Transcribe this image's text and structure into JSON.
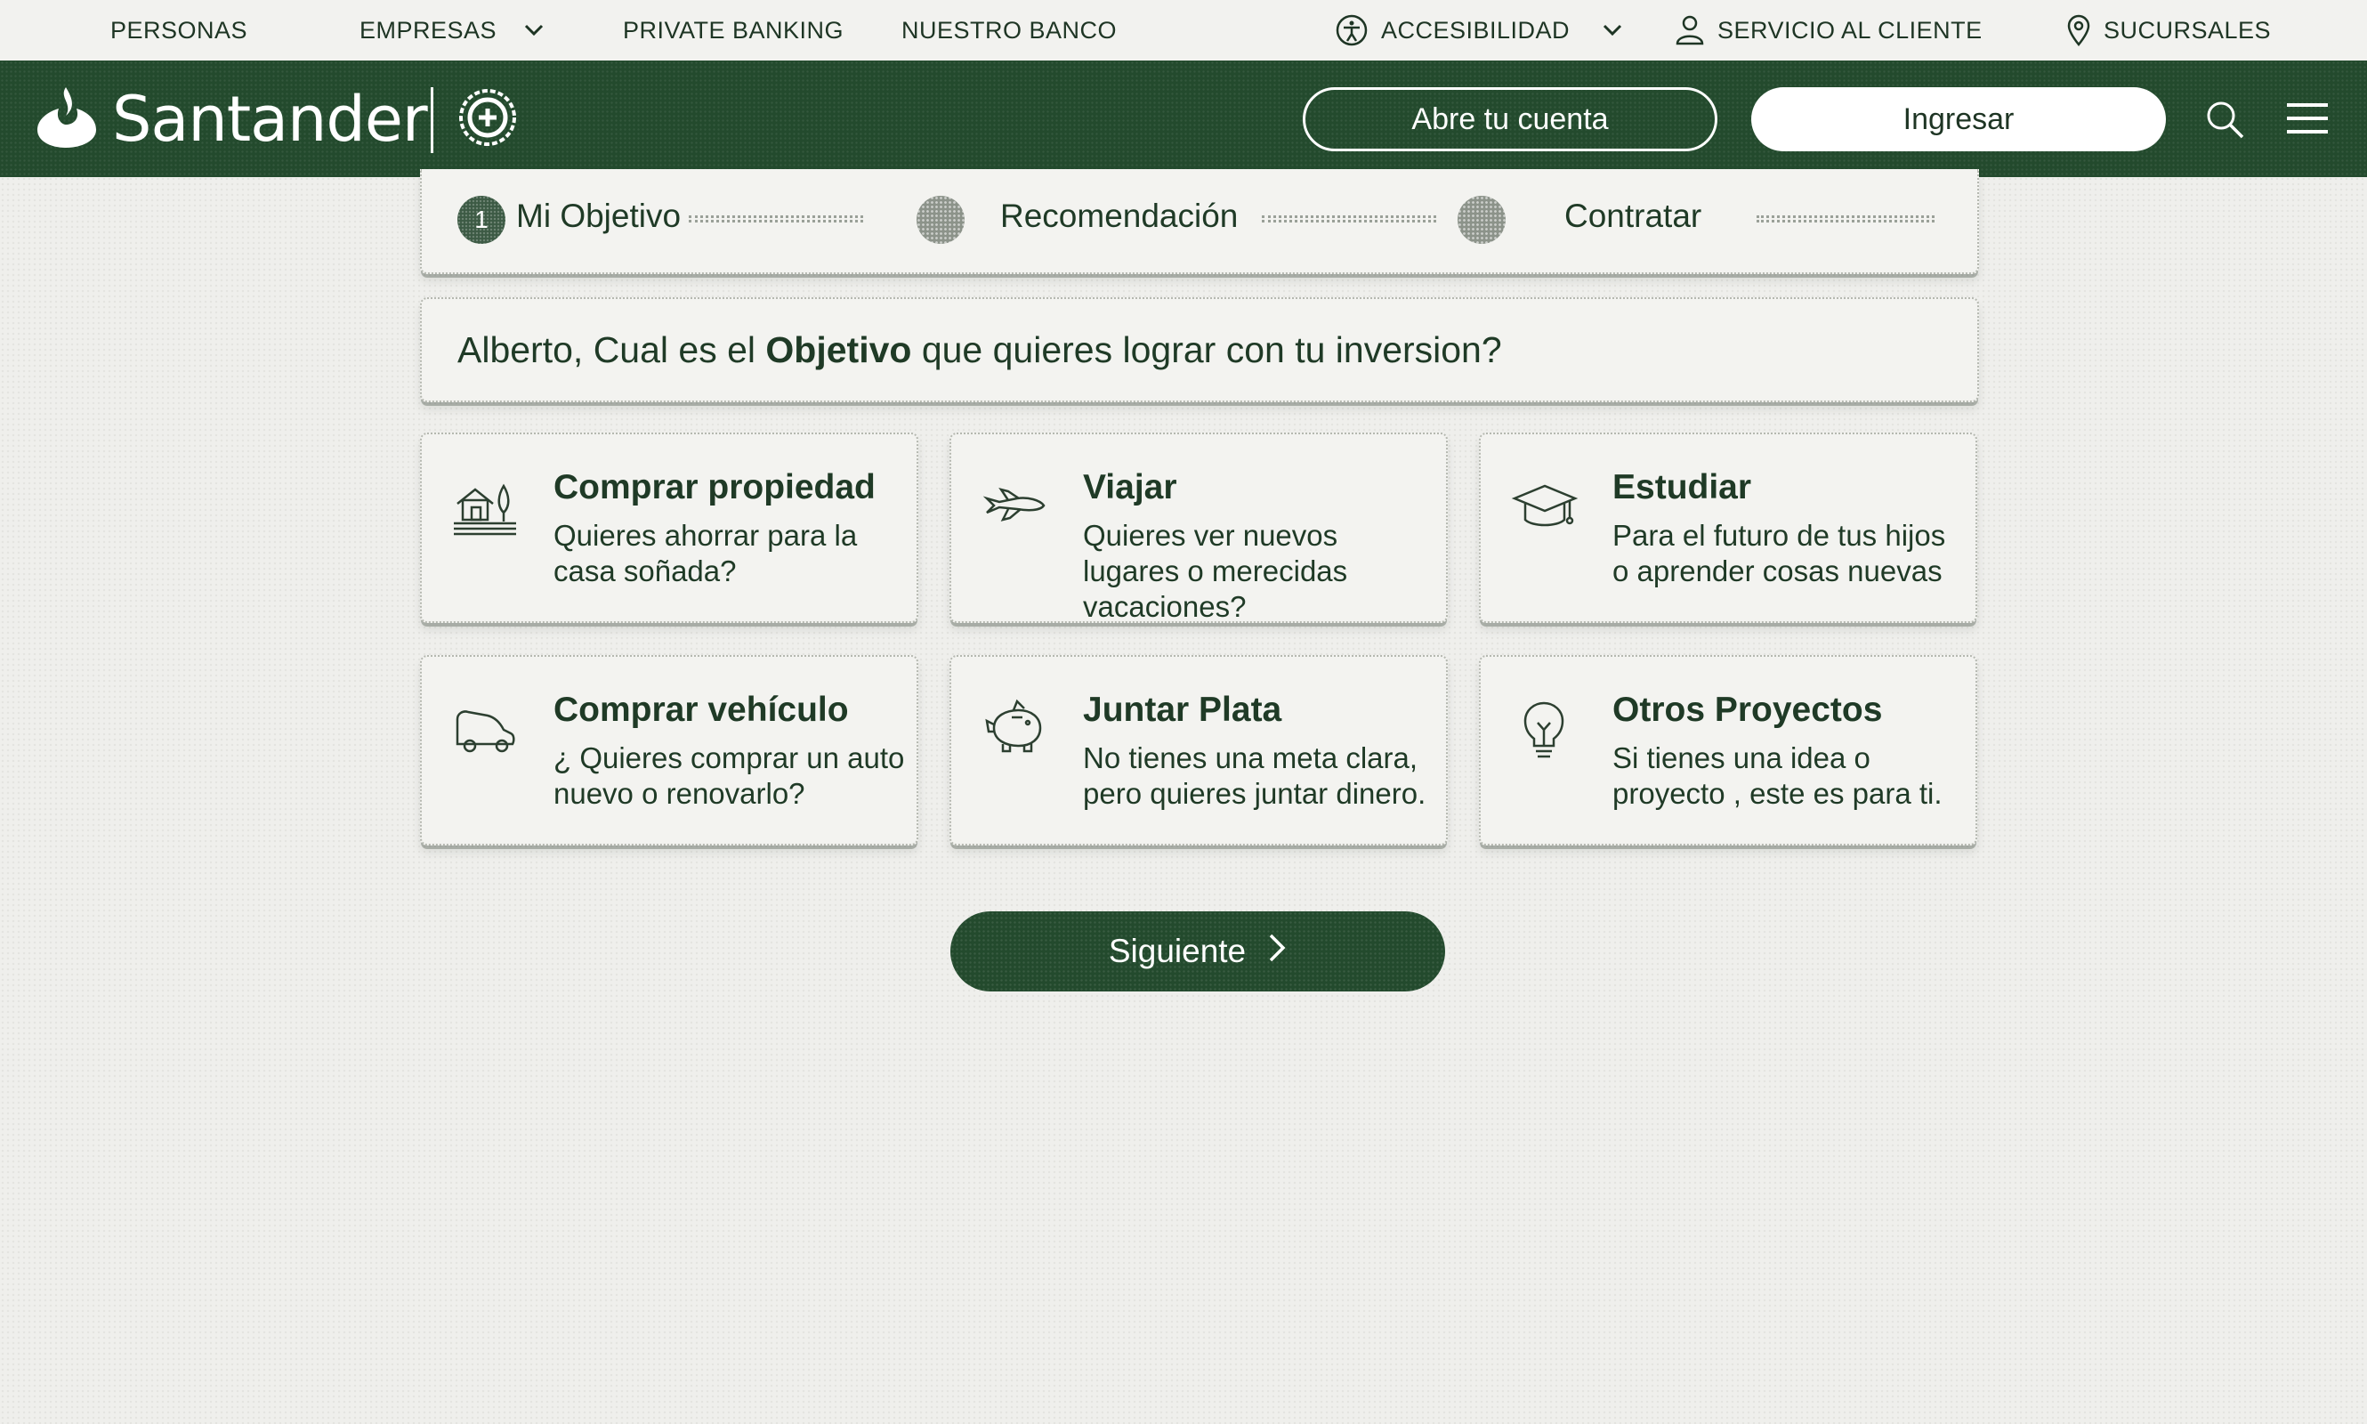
{
  "topnav": {
    "personas": "PERSONAS",
    "empresas": "EMPRESAS",
    "private_banking": "PRIVATE BANKING",
    "nuestro_banco": "NUESTRO BANCO",
    "accesibilidad": "ACCESIBILIDAD",
    "servicio_cliente": "SERVICIO AL CLIENTE",
    "sucursales": "SUCURSALES"
  },
  "header": {
    "brand": "Santander",
    "open_account": "Abre tu cuenta",
    "login": "Ingresar"
  },
  "stepper": {
    "steps": [
      {
        "number": "1",
        "label": "Mi Objetivo",
        "active": true
      },
      {
        "number": "",
        "label": "Recomendación",
        "active": false
      },
      {
        "number": "",
        "label": "Contratar",
        "active": false
      }
    ]
  },
  "question": {
    "prefix": "Alberto, Cual es el ",
    "emphasis": "Objetivo",
    "suffix": " que quieres lograr con tu inversion?"
  },
  "options": [
    {
      "icon": "house-icon",
      "title": "Comprar propiedad",
      "desc": "Quieres ahorrar para la casa soñada?"
    },
    {
      "icon": "airplane-icon",
      "title": "Viajar",
      "desc": "Quieres ver nuevos lugares o merecidas vacaciones?"
    },
    {
      "icon": "graduation-cap-icon",
      "title": "Estudiar",
      "desc": "Para el futuro de tus hijos o aprender cosas nuevas"
    },
    {
      "icon": "car-icon",
      "title": "Comprar vehículo",
      "desc": "¿ Quieres comprar un auto nuevo o renovarlo?"
    },
    {
      "icon": "piggy-bank-icon",
      "title": "Juntar Plata",
      "desc": "No tienes una meta clara, pero quieres juntar dinero."
    },
    {
      "icon": "lightbulb-icon",
      "title": "Otros Proyectos",
      "desc": "Si tienes una idea o proyecto , este es para ti."
    }
  ],
  "next_button": "Siguiente",
  "colors": {
    "brand_green": "#234a2d",
    "text": "#1f3a26",
    "background": "#efefec"
  }
}
